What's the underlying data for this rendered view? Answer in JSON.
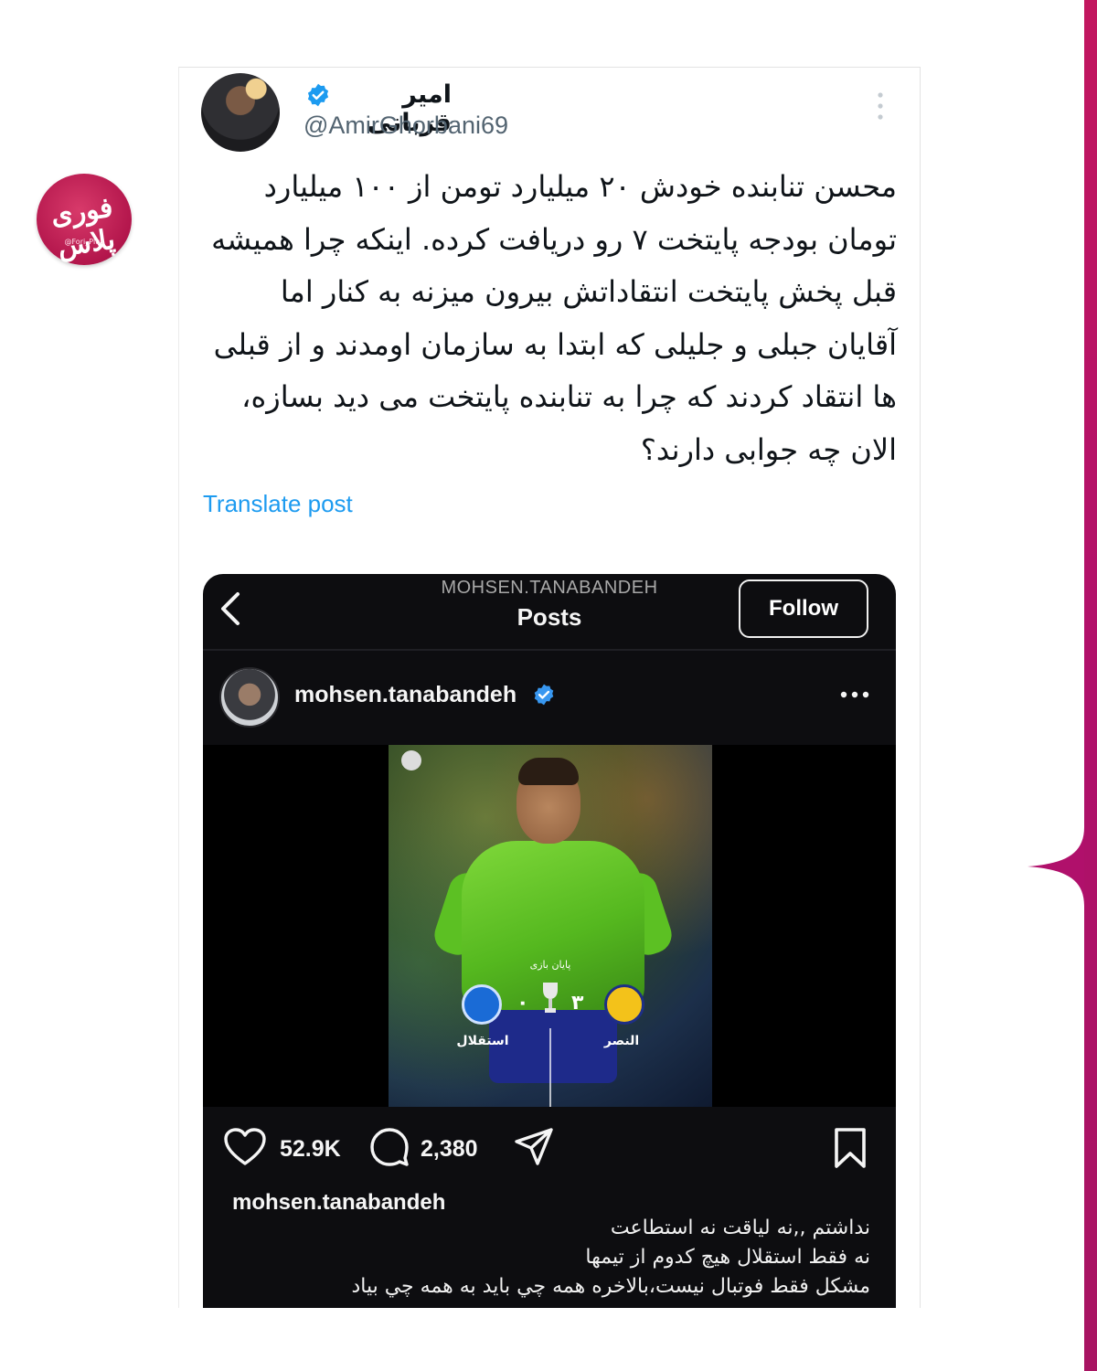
{
  "brand": {
    "logo_text": "فوری پلاس",
    "logo_subtext": "@Fori_Plus",
    "accent_color": "#b3164c",
    "edge_color": "#b0106b"
  },
  "tweet": {
    "display_name": "امیر قربانی",
    "handle": "@AmirGhorbani69",
    "verified": true,
    "text": "محسن تنابنده خودش ۲۰ میلیارد تومن از ۱۰۰ میلیارد تومان بودجه پایتخت ۷ رو دریافت کرده. اینکه چرا همیشه قبل پخش پایتخت انتقاداتش بیرون میزنه به کنار اما آقایان جبلی و جلیلی که ابتدا به سازمان اومدند و از قبلی ها انتقاد کردند که چرا به تنابنده پایتخت می دید بسازه، الان چه جوابی دارند؟",
    "translate_label": "Translate post",
    "link_color": "#1d9bf0"
  },
  "instagram": {
    "header_username": "MOHSEN.TANABANDEH",
    "header_title": "Posts",
    "follow_label": "Follow",
    "post_username": "mohsen.tanabandeh",
    "verified": true,
    "media": {
      "match_status": "پایان بازی",
      "team_left": "استقلال",
      "team_right": "النصر",
      "score_left": "۰",
      "score_right": "۳"
    },
    "likes": "52.9K",
    "comments": "2,380",
    "caption_username": "mohsen.tanabandeh",
    "caption_lines": [
      "نداشتم ,,نه لیاقت نه استطاعت",
      "نه فقط استقلال هیچ کدوم از تیمها",
      "مشکل فقط فوتبال نیست،بالاخره همه چي بايد به همه چي بياد"
    ]
  }
}
